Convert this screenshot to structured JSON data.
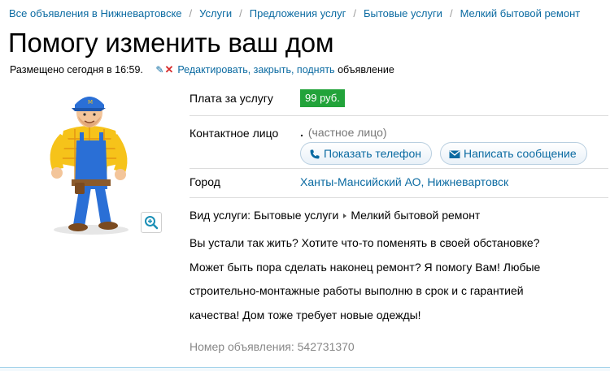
{
  "breadcrumbs": [
    "Все объявления в Нижневартовске",
    "Услуги",
    "Предложения услуг",
    "Бытовые услуги",
    "Мелкий бытовой ремонт"
  ],
  "title": "Помогу изменить ваш дом",
  "meta": {
    "posted": "Размещено сегодня в 16:59.",
    "edit_link": "Редактировать, закрыть, поднять",
    "edit_suffix": "объявление"
  },
  "details": {
    "price_label": "Плата за услугу",
    "price_value": "99 руб.",
    "contact_label": "Контактное лицо",
    "contact_name": ".",
    "contact_type": "(частное лицо)",
    "show_phone_button": "Показать телефон",
    "write_message_button": "Написать сообщение",
    "city_label": "Город",
    "city_value": "Ханты-Мансийский АО, Нижневартовск"
  },
  "service": {
    "label": "Вид услуги:",
    "category": "Бытовые услуги",
    "subcategory": "Мелкий бытовой ремонт"
  },
  "description": "Вы устали так жить? Хотите что-то поменять в своей обстановке? Может быть пора сделать наконец ремонт? Я помогу Вам! Любые строительно-монтажные работы выполню в срок и с гарантией качества! Дом тоже требует новые одежды!",
  "ad_number": "Номер объявления: 542731370",
  "colors": {
    "link": "#0a6aa1",
    "price_badge": "#22a33a",
    "delete_cross": "#d62a2a"
  },
  "icons": [
    "pencil-icon",
    "delete-icon",
    "zoom-icon",
    "phone-icon",
    "envelope-icon"
  ]
}
